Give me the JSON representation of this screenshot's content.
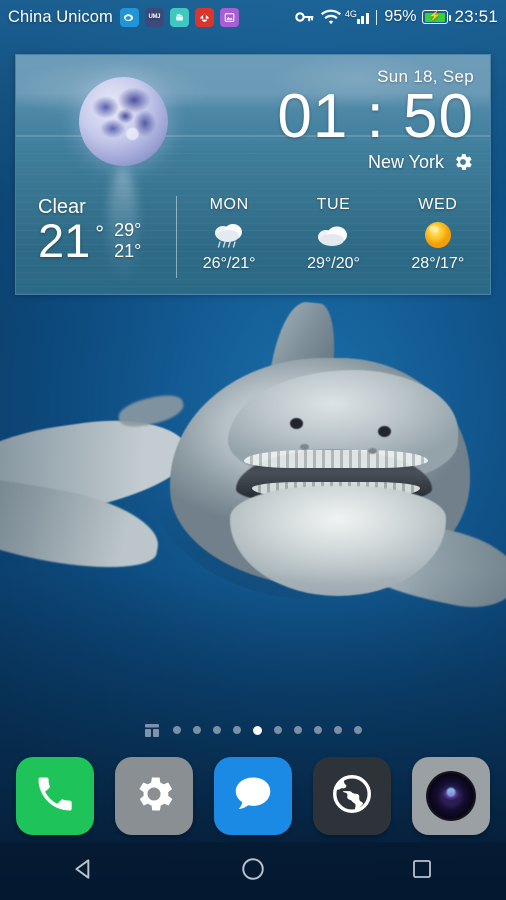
{
  "statusbar": {
    "carrier": "China Unicom",
    "notification_icons": [
      {
        "name": "weibo-icon",
        "glyph": "☁"
      },
      {
        "name": "uma-icon",
        "glyph": "UMJ"
      },
      {
        "name": "android-app-icon",
        "glyph": "◑"
      },
      {
        "name": "huawei-icon",
        "glyph": "✽"
      },
      {
        "name": "photo-icon",
        "glyph": "❐"
      }
    ],
    "vpn_key_icon": "key-icon",
    "wifi_icon": "wifi-icon",
    "network_type": "4G",
    "signal_icon": "signal-bars-icon",
    "battery_percent": "95%",
    "battery_icon": "battery-charging-icon",
    "clock": "23:51"
  },
  "weather_widget": {
    "date": "Sun  18, Sep",
    "time": "01 : 50",
    "city": "New York",
    "settings_icon": "gear-icon",
    "moon_icon": "moon-icon",
    "current": {
      "condition": "Clear",
      "temperature": "21",
      "degree_symbol": "°",
      "high": "29°",
      "low": "21°"
    },
    "forecast": [
      {
        "day": "MON",
        "icon": "rain-cloud-icon",
        "temps": "26°/21°"
      },
      {
        "day": "TUE",
        "icon": "cloud-icon",
        "temps": "29°/20°"
      },
      {
        "day": "WED",
        "icon": "sun-icon",
        "temps": "28°/17°"
      }
    ]
  },
  "page_indicator": {
    "widget_button_icon": "widget-layout-icon",
    "total_pages": 10,
    "active_page": 5
  },
  "dock": {
    "apps": [
      {
        "name": "phone",
        "icon": "phone-icon",
        "color": "#1ec35a"
      },
      {
        "name": "settings",
        "icon": "gear-icon",
        "color": "#8a8f94"
      },
      {
        "name": "messages",
        "icon": "speech-bubble-icon",
        "color": "#1b8ae5"
      },
      {
        "name": "browser",
        "icon": "globe-icon",
        "color": "#2d3339"
      },
      {
        "name": "camera",
        "icon": "camera-lens-icon",
        "color": "#9aa0a4"
      }
    ]
  },
  "navbar": {
    "back_icon": "back-triangle-icon",
    "home_icon": "home-circle-icon",
    "recents_icon": "recents-square-icon"
  },
  "wallpaper": {
    "subject": "great-white-shark",
    "background_color": "#0d4d82"
  }
}
